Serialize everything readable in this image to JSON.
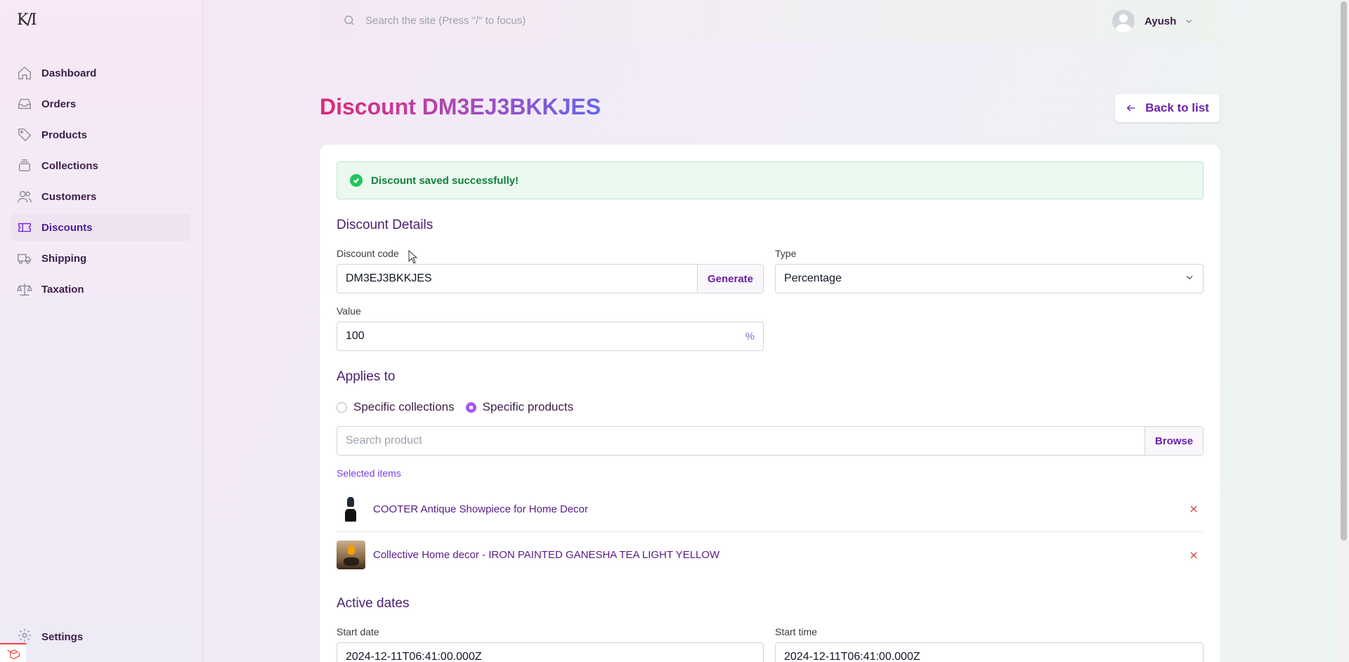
{
  "app": {
    "logo_text": "K/I"
  },
  "sidebar": {
    "items": [
      {
        "label": "Dashboard",
        "icon": "home-icon",
        "active": false
      },
      {
        "label": "Orders",
        "icon": "inbox-icon",
        "active": false
      },
      {
        "label": "Products",
        "icon": "tag-icon",
        "active": false
      },
      {
        "label": "Collections",
        "icon": "stack-icon",
        "active": false
      },
      {
        "label": "Customers",
        "icon": "users-icon",
        "active": false
      },
      {
        "label": "Discounts",
        "icon": "ticket-icon",
        "active": true
      },
      {
        "label": "Shipping",
        "icon": "truck-icon",
        "active": false
      },
      {
        "label": "Taxation",
        "icon": "scale-icon",
        "active": false
      }
    ],
    "settings_label": "Settings"
  },
  "topbar": {
    "search_placeholder": "Search the site (Press \"/\" to focus)",
    "user_name": "Ayush"
  },
  "header": {
    "title": "Discount DM3EJ3BKKJES",
    "back_label": "Back to list"
  },
  "alert": {
    "message": "Discount saved successfully!"
  },
  "details": {
    "section_title": "Discount Details",
    "code_label": "Discount code",
    "code_value": "DM3EJ3BKKJES",
    "generate_label": "Generate",
    "type_label": "Type",
    "type_value": "Percentage",
    "value_label": "Value",
    "value_value": "100",
    "value_suffix": "%"
  },
  "applies_to": {
    "section_title": "Applies to",
    "options": [
      {
        "label": "Specific collections",
        "checked": false
      },
      {
        "label": "Specific products",
        "checked": true
      }
    ],
    "search_placeholder": "Search product",
    "browse_label": "Browse",
    "selected_title": "Selected items",
    "items": [
      {
        "name": "COOTER Antique Showpiece for Home Decor"
      },
      {
        "name": "Collective Home decor - IRON PAINTED GANESHA TEA LIGHT YELLOW"
      }
    ]
  },
  "active_dates": {
    "section_title": "Active dates",
    "start_date_label": "Start date",
    "start_date_value": "2024-12-11T06:41:00.000Z",
    "start_time_label": "Start time",
    "start_time_value": "2024-12-11T06:41:00.000Z"
  },
  "colors": {
    "accent": "#6b21a8",
    "title_gradient_start": "#db2777",
    "title_gradient_end": "#6366f1",
    "success": "#22c55e",
    "danger": "#dc2626"
  }
}
